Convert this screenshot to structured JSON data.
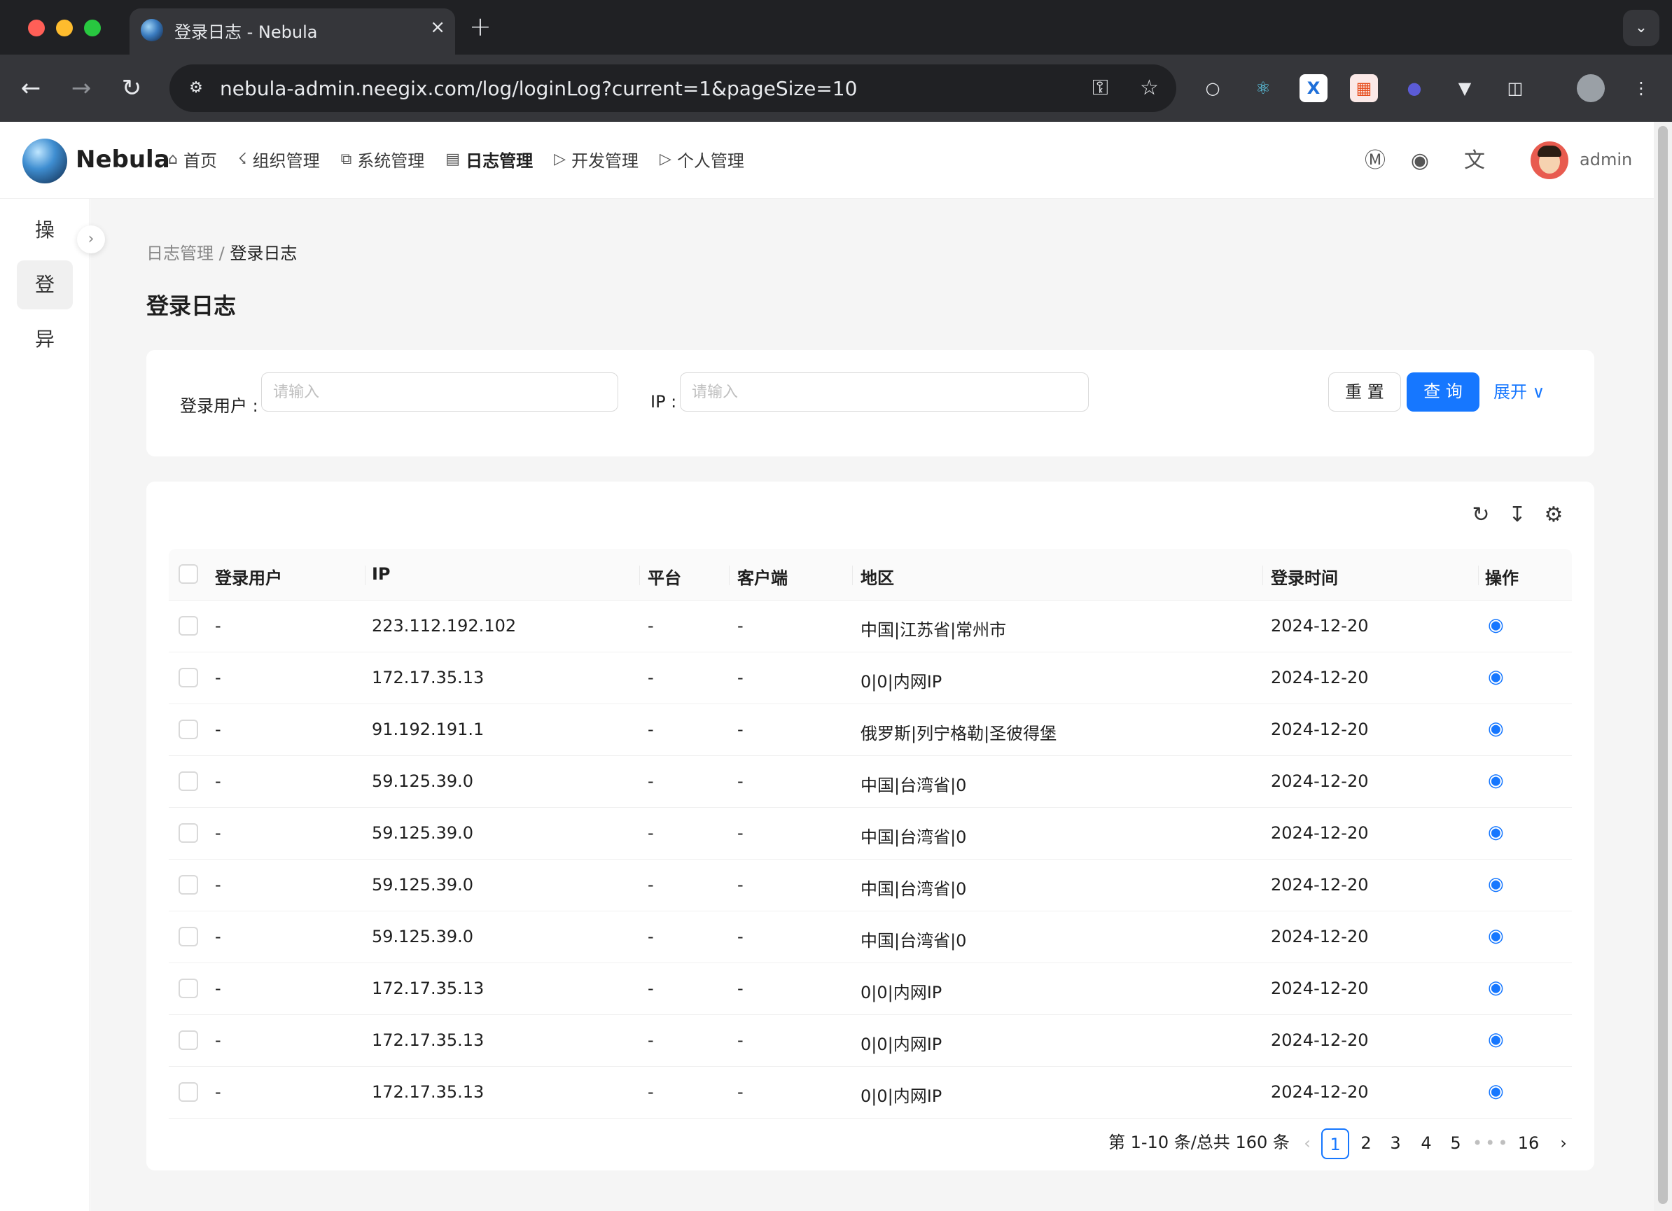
{
  "browser": {
    "tab_title": "登录日志 - Nebula",
    "url": "nebula-admin.neegix.com/log/loginLog?current=1&pageSize=10",
    "new_tab": "+",
    "close": "×"
  },
  "header": {
    "logo_text": "Nebula",
    "nav": [
      {
        "label": "首页",
        "icon": "home-icon"
      },
      {
        "label": "组织管理",
        "icon": "org-icon"
      },
      {
        "label": "系统管理",
        "icon": "system-icon"
      },
      {
        "label": "日志管理",
        "icon": "log-icon"
      },
      {
        "label": "开发管理",
        "icon": "terminal-icon"
      },
      {
        "label": "个人管理",
        "icon": "terminal-icon"
      }
    ],
    "username": "admin"
  },
  "sider": {
    "items": [
      "操",
      "登",
      "异"
    ],
    "active_index": 1
  },
  "breadcrumb": {
    "parent": "日志管理",
    "separator": "/",
    "current": "登录日志"
  },
  "page_title": "登录日志",
  "search": {
    "user_label": "登录用户 :",
    "user_placeholder": "请输入",
    "ip_label": "IP :",
    "ip_placeholder": "请输入",
    "reset_label": "重 置",
    "query_label": "查 询",
    "expand_label": "展开"
  },
  "table": {
    "columns": [
      "登录用户",
      "IP",
      "平台",
      "客户端",
      "地区",
      "登录时间",
      "操作"
    ],
    "rows": [
      {
        "user": "-",
        "ip": "223.112.192.102",
        "platform": "-",
        "client": "-",
        "region": "中国|江苏省|常州市",
        "time": "2024-12-20"
      },
      {
        "user": "-",
        "ip": "172.17.35.13",
        "platform": "-",
        "client": "-",
        "region": "0|0|内网IP",
        "time": "2024-12-20"
      },
      {
        "user": "-",
        "ip": "91.192.191.1",
        "platform": "-",
        "client": "-",
        "region": "俄罗斯|列宁格勒|圣彼得堡",
        "time": "2024-12-20"
      },
      {
        "user": "-",
        "ip": "59.125.39.0",
        "platform": "-",
        "client": "-",
        "region": "中国|台湾省|0",
        "time": "2024-12-20"
      },
      {
        "user": "-",
        "ip": "59.125.39.0",
        "platform": "-",
        "client": "-",
        "region": "中国|台湾省|0",
        "time": "2024-12-20"
      },
      {
        "user": "-",
        "ip": "59.125.39.0",
        "platform": "-",
        "client": "-",
        "region": "中国|台湾省|0",
        "time": "2024-12-20"
      },
      {
        "user": "-",
        "ip": "59.125.39.0",
        "platform": "-",
        "client": "-",
        "region": "中国|台湾省|0",
        "time": "2024-12-20"
      },
      {
        "user": "-",
        "ip": "172.17.35.13",
        "platform": "-",
        "client": "-",
        "region": "0|0|内网IP",
        "time": "2024-12-20"
      },
      {
        "user": "-",
        "ip": "172.17.35.13",
        "platform": "-",
        "client": "-",
        "region": "0|0|内网IP",
        "time": "2024-12-20"
      },
      {
        "user": "-",
        "ip": "172.17.35.13",
        "platform": "-",
        "client": "-",
        "region": "0|0|内网IP",
        "time": "2024-12-20"
      }
    ]
  },
  "pagination": {
    "summary": "第 1-10 条/总共 160 条",
    "pages": [
      "1",
      "2",
      "3",
      "4",
      "5"
    ],
    "dots": "•••",
    "last_page": "16",
    "current": "1"
  },
  "colors": {
    "primary": "#1677ff",
    "page_bg": "#f5f5f5",
    "chrome_dark": "#202124"
  }
}
